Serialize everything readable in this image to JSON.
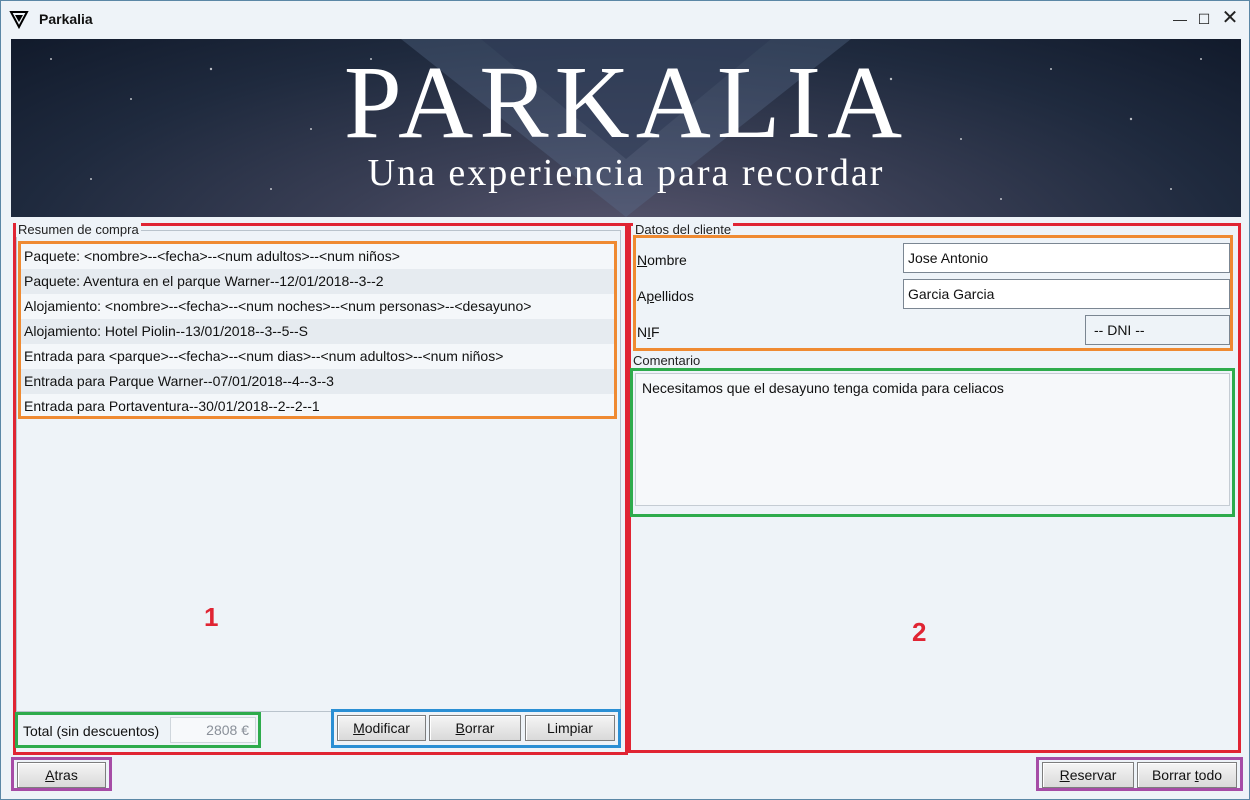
{
  "window": {
    "title": "Parkalia",
    "controls": {
      "minimize": "—",
      "maximize": "☐",
      "close": "✕"
    }
  },
  "banner": {
    "title": "PARKALIA",
    "subtitle": "Una experiencia para recordar"
  },
  "left_panel": {
    "group_label": "Resumen de compra",
    "items": [
      "Paquete: <nombre>--<fecha>--<num adultos>--<num niños>",
      "Paquete: Aventura en el parque Warner--12/01/2018--3--2",
      "Alojamiento: <nombre>--<fecha>--<num noches>--<num personas>--<desayuno>",
      "Alojamiento: Hotel Piolin--13/01/2018--3--5--S",
      "Entrada para <parque>--<fecha>--<num dias>--<num adultos>--<num niños>",
      "Entrada para Parque Warner--07/01/2018--4--3--3",
      "Entrada para Portaventura--30/01/2018--2--2--1"
    ],
    "marker": "1",
    "total_label": "Total (sin descuentos)",
    "total_value": "2808 €",
    "buttons": {
      "modificar": "Modificar",
      "borrar": "Borrar",
      "limpiar": "Limpiar"
    }
  },
  "right_panel": {
    "group_label": "Datos del cliente",
    "fields": {
      "nombre_label": "Nombre",
      "nombre_value": "Jose Antonio",
      "apellidos_label": "Apellidos",
      "apellidos_value": "Garcia Garcia",
      "nif_label": "NIF",
      "nif_select": "-- DNI --"
    },
    "comment_label": "Comentario",
    "comment_value": "Necesitamos que el desayuno tenga comida para celiacos",
    "marker": "2"
  },
  "footer": {
    "atras": "Atras",
    "reservar": "Reservar",
    "borrar_todo": "Borrar todo"
  },
  "colors": {
    "red_outline": "#e02433",
    "orange_outline": "#ef8a32",
    "green_outline": "#2eab4c",
    "blue_outline": "#2b8fd4",
    "purple_outline": "#a64ca6"
  }
}
